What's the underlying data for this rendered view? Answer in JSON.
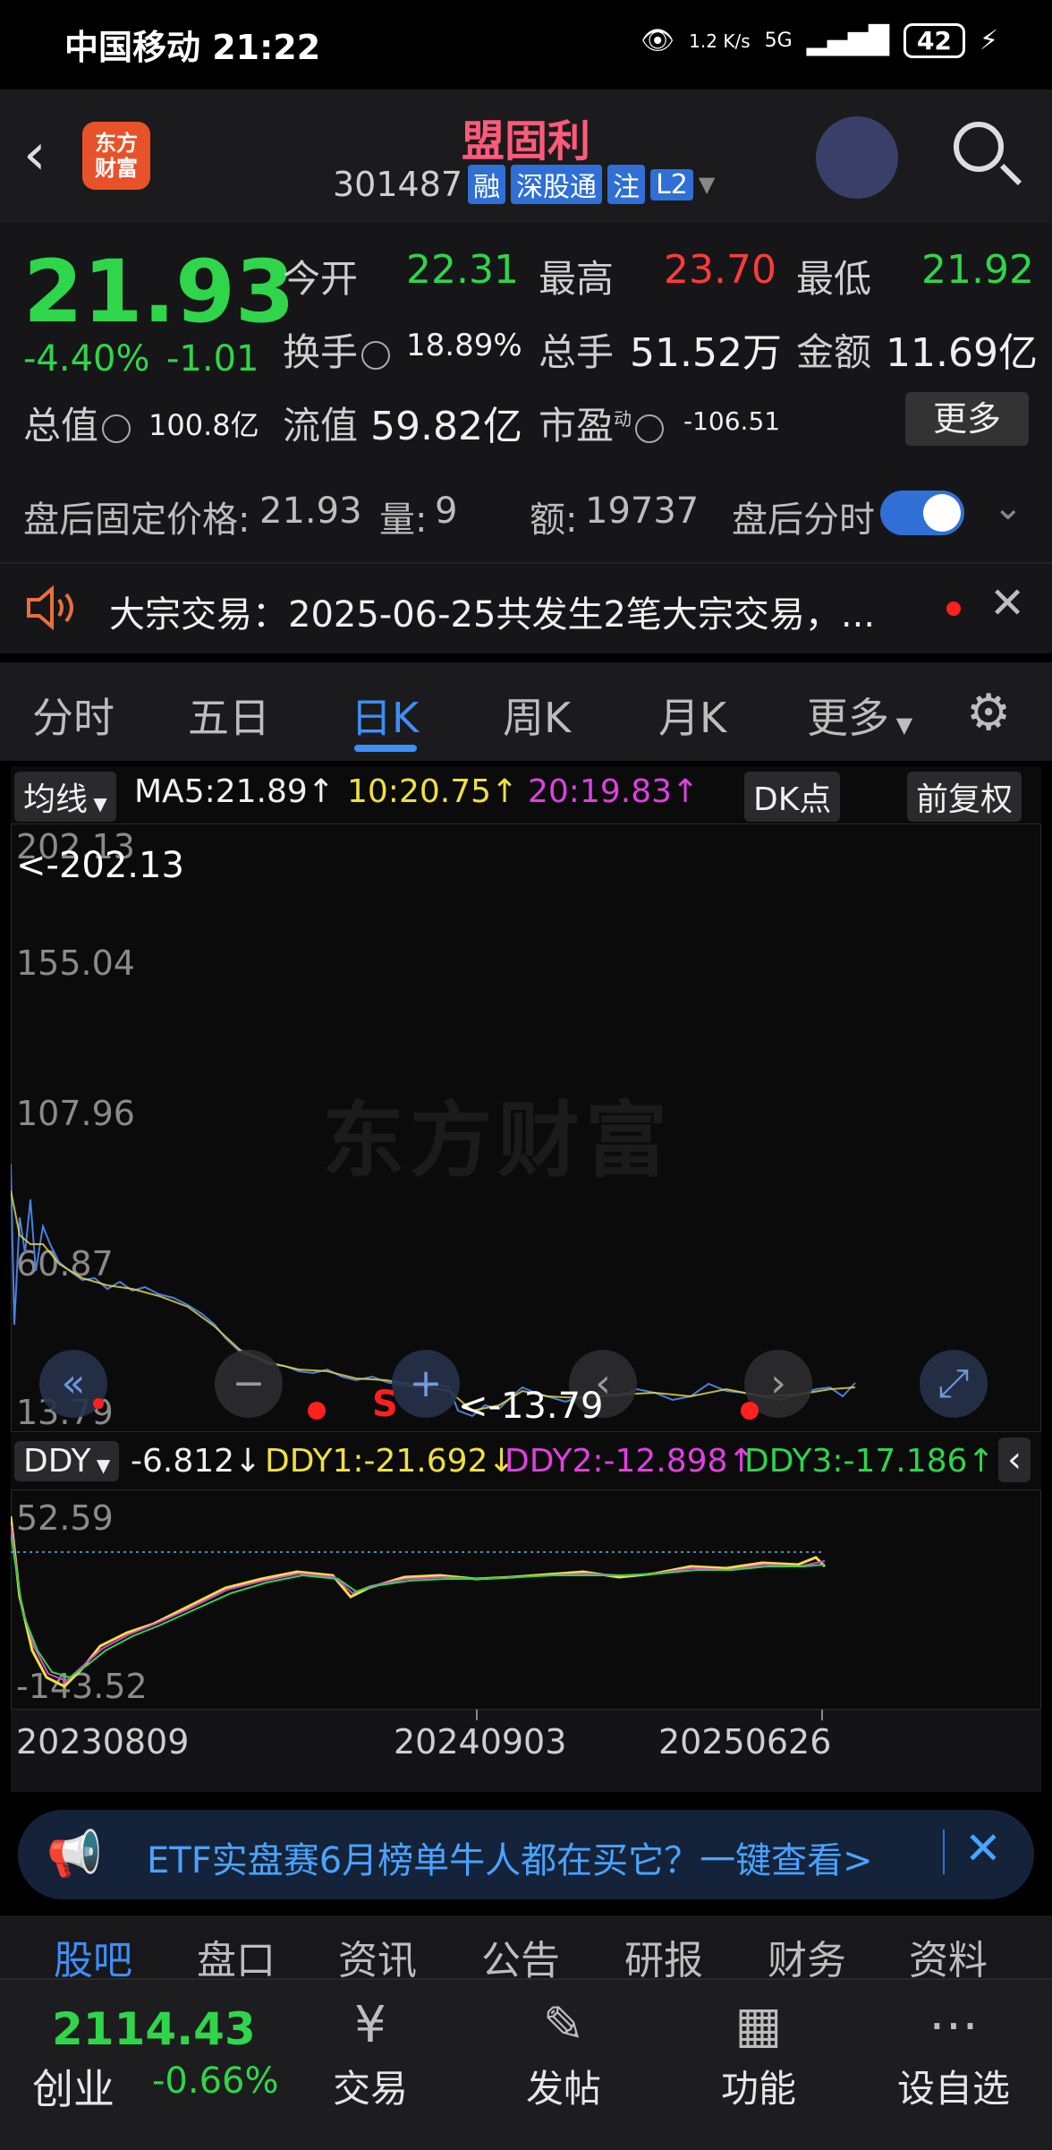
{
  "status": {
    "carrier": "中国移动 21:22",
    "speed": "1.2 K/s",
    "network": "5G",
    "battery": "42"
  },
  "header": {
    "logo_line1": "东方",
    "logo_line2": "财富",
    "title": "盟固利",
    "code": "301487",
    "tags": [
      "融",
      "深股通",
      "注",
      "L2"
    ]
  },
  "quote": {
    "price": "21.93",
    "change_pct": "-4.40%",
    "change_abs": "-1.01",
    "open_label": "今开",
    "open": "22.31",
    "high_label": "最高",
    "high": "23.70",
    "low_label": "最低",
    "low": "21.92",
    "turnover_label": "换手",
    "turnover": "18.89%",
    "volume_label": "总手",
    "volume": "51.52万",
    "amount_label": "金额",
    "amount": "11.69亿",
    "mktcap_label": "总值",
    "mktcap": "100.8亿",
    "float_label": "流值",
    "float_cap": "59.82亿",
    "pe_label": "市盈",
    "pe_sup": "动",
    "pe": "-106.51",
    "more": "更多"
  },
  "afterhours": {
    "label": "盘后固定价格:",
    "price": "21.93",
    "vol_label": "量:",
    "vol": "9",
    "amt_label": "额:",
    "amt": "19737",
    "switch_label": "盘后分时"
  },
  "notice": {
    "text": "大宗交易：2025-06-25共发生2笔大宗交易，..."
  },
  "tabs": [
    "分时",
    "五日",
    "日K",
    "周K",
    "月K",
    "更多"
  ],
  "active_tab": "日K",
  "ma": {
    "selector": "均线",
    "ma5": "MA5:21.89↑",
    "ma10": "10:20.75↑",
    "ma20": "20:19.83↑",
    "dk": "DK点",
    "adjust": "前复权"
  },
  "kchart": {
    "y_labels": [
      "202.13",
      "155.04",
      "107.96",
      "60.87",
      "13.79"
    ],
    "max_marker": "<-202.13",
    "min_marker": "<-13.79",
    "watermark": "东方财富",
    "markers": [
      "S"
    ],
    "colors": {
      "line": "#4a7fe0",
      "ma10": "#f0e040",
      "ma20": "#e040e0"
    }
  },
  "ddy": {
    "selector": "DDY",
    "ddy": "-6.812↓",
    "ddy1": "DDY1:-21.692↓",
    "ddy2": "DDY2:-12.898↑",
    "ddy3": "DDY3:-17.186↑",
    "top": "52.59",
    "bottom": "-143.52"
  },
  "dates": [
    "20230809",
    "20240903",
    "20250626"
  ],
  "ad": {
    "text": "ETF实盘赛6月榜单牛人都在买它？一键查看>"
  },
  "bottom_tabs": [
    "股吧",
    "盘口",
    "资讯",
    "公告",
    "研报",
    "财务",
    "资料"
  ],
  "nav": {
    "index_value": "2114.43",
    "index_name": "创业",
    "index_change": "-0.66%",
    "items": [
      {
        "label": "交易",
        "icon": "yen-trade-icon"
      },
      {
        "label": "发帖",
        "icon": "edit-icon"
      },
      {
        "label": "功能",
        "icon": "grid-icon"
      },
      {
        "label": "设自选",
        "icon": "more-dots-icon"
      }
    ]
  },
  "chart_data": {
    "type": "line",
    "series": [],
    "ylim": [
      -143.52,
      202.13
    ],
    "x": [
      "20230809",
      "20240903",
      "20250626"
    ]
  }
}
